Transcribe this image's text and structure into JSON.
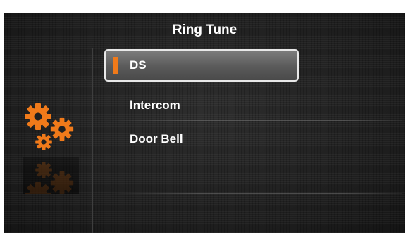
{
  "header": {
    "title": "Ring Tune"
  },
  "menu": {
    "items": [
      {
        "label": "DS",
        "selected": true
      },
      {
        "label": "Intercom",
        "selected": false
      },
      {
        "label": "Door Bell",
        "selected": false
      }
    ]
  },
  "sidebar": {
    "icon": "gears-icon"
  },
  "colors": {
    "accent": "#f07a1a",
    "background": "#202020",
    "text": "#ffffff",
    "selection_border": "#e8e8e8"
  }
}
